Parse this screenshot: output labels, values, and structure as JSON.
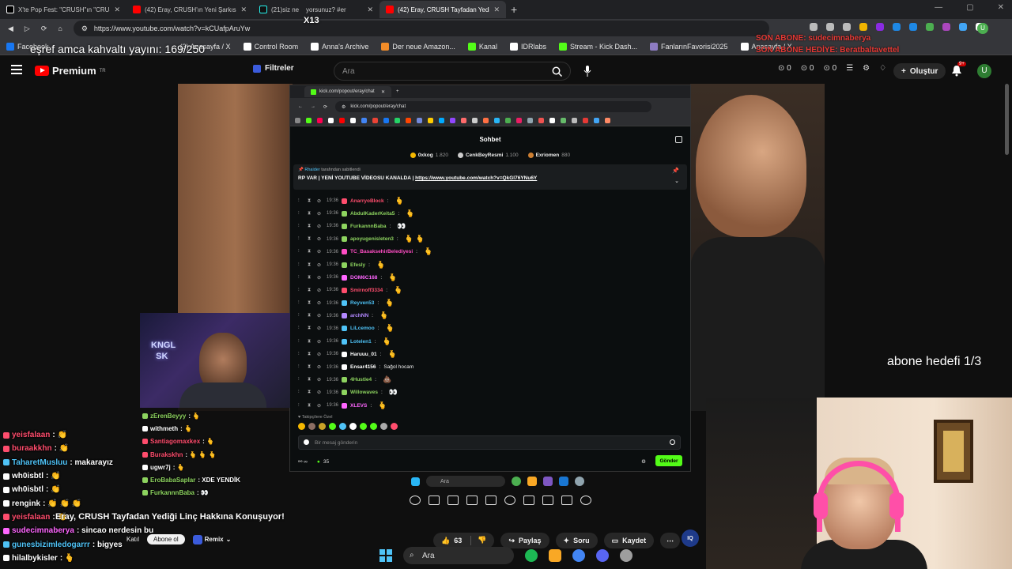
{
  "browser": {
    "tabs": [
      {
        "title": "X'te Pop Fest: \"CRUSH\"ın \"CRUSH",
        "icon": "x-icon",
        "color": "#ffffff",
        "active": false
      },
      {
        "title": "(42) Eray, CRUSH'ın Yeni Şarkısın",
        "icon": "youtube-icon",
        "color": "#ff0000",
        "active": false
      },
      {
        "title": "(21)siz ne",
        "title_tail": "yorsunuz? #er",
        "icon": "tiktok-icon",
        "color": "#ffffff",
        "active": false
      },
      {
        "title": "(42) Eray, CRUSH Tayfadan Yediğ",
        "icon": "youtube-icon",
        "color": "#ff0000",
        "active": true
      }
    ],
    "url": "https://www.youtube.com/watch?v=kCUafpAruYw",
    "bookmarks": [
      {
        "label": "Facebook",
        "color": "#1877f2"
      },
      {
        "label": "(3) Anasayfa / X",
        "color": "#ffffff"
      },
      {
        "label": "Control Room",
        "color": "#ffffff"
      },
      {
        "label": "Anna's Archive",
        "color": "#ffffff"
      },
      {
        "label": "Der neue Amazon...",
        "color": "#f28c28"
      },
      {
        "label": "Kanal",
        "color": "#53fc18"
      },
      {
        "label": "IDRlabs",
        "color": "#ffffff"
      },
      {
        "label": "Stream - Kick Dash...",
        "color": "#53fc18"
      },
      {
        "label": "FanlarınFavorisi2025",
        "color": "#8e7cc3"
      },
      {
        "label": "Anasayfa / X",
        "color": "#ffffff"
      }
    ]
  },
  "overlay": {
    "subgoal_counter": "eşref amca kahvaltı yayını: 169/250",
    "gift_count": "X13",
    "son_abone": "SON ABONE: sudecimnaberya",
    "son_abone_hediye": "SON ABONE HEDİYE: Beratbaltavettel",
    "abone_hedefi": "abone hedefi 1/3"
  },
  "youtube": {
    "brand": "Premium",
    "region": "TR",
    "filters_label": "Filtreler",
    "search_placeholder": "Ara",
    "counters": [
      "0",
      "0",
      "0"
    ],
    "create_label": "Oluştur",
    "notif_badge": "9+",
    "avatar_letter": "U",
    "video_title": "Eray, CRUSH Tayfadan Yediği Linç Hakkına Konuşuyor!",
    "join_label": "Katıl",
    "subscribe_label": "Abone ol",
    "remix_label": "Remix",
    "likes": "63",
    "share_label": "Paylaş",
    "ask_label": "Soru",
    "save_label": "Kaydet",
    "iq_label": "IQ"
  },
  "kick": {
    "tab_title": "kick.com/popout/eray/chat",
    "url": "kick.com/popout/eray/chat",
    "header": "Sohbet",
    "top_gifters": [
      {
        "name": "0xkog",
        "amount": "1.820",
        "color": "#f5b800"
      },
      {
        "name": "CenkBeyResmi",
        "amount": "1.100",
        "color": "#cccccc"
      },
      {
        "name": "Exriomen",
        "amount": "880",
        "color": "#cd7f32"
      }
    ],
    "pinned_by_user": "Rhaider",
    "pinned_by_suffix": "tarafından sabitlendi",
    "pinned_text": "RP VAR | YENİ YOUTUBE VİDEOSU KANALDA | ",
    "pinned_link": "https://www.youtube.com/watch?v=QkGl76YNu6Y",
    "messages": [
      {
        "time": "19:36",
        "user": "AnarryoBlock",
        "color": "#ff4d6d",
        "text": "",
        "emote": "🫰"
      },
      {
        "time": "19:36",
        "user": "AbdulKaderKeita5",
        "color": "#8dd35f",
        "text": "",
        "emote": "🫰"
      },
      {
        "time": "19:36",
        "user": "FurkannnBaba",
        "color": "#8dd35f",
        "text": "",
        "emote": "👀"
      },
      {
        "time": "19:36",
        "user": "apoyugenisleten3",
        "color": "#8dd35f",
        "text": "",
        "emote": "🫰 🫰"
      },
      {
        "time": "19:36",
        "user": "TC_BasaksehirBelediyesi",
        "color": "#ff4dc4",
        "text": "",
        "emote": "🫰"
      },
      {
        "time": "19:36",
        "user": "Efesly",
        "color": "#8dd35f",
        "text": "",
        "emote": "🫰"
      },
      {
        "time": "19:36",
        "user": "DOM6C168",
        "color": "#ff66ff",
        "text": "",
        "emote": "🫰"
      },
      {
        "time": "19:36",
        "user": "Smirnoff3334",
        "color": "#ff4d6d",
        "text": "",
        "emote": "🫰"
      },
      {
        "time": "19:36",
        "user": "Reyven53",
        "color": "#4fc3f7",
        "text": "",
        "emote": "🫰"
      },
      {
        "time": "19:36",
        "user": "archNN",
        "color": "#b388ff",
        "text": "",
        "emote": "🫰"
      },
      {
        "time": "19:36",
        "user": "LiLcemoo",
        "color": "#4fc3f7",
        "text": "",
        "emote": "🫰"
      },
      {
        "time": "19:36",
        "user": "Lotelen1",
        "color": "#4fc3f7",
        "text": "",
        "emote": "🫰"
      },
      {
        "time": "19:36",
        "user": "Haruuu_01",
        "color": "#ffffff",
        "text": "",
        "emote": "🫰"
      },
      {
        "time": "19:36",
        "user": "Ensar4156",
        "color": "#ffffff",
        "text": "Sağol hocam",
        "emote": ""
      },
      {
        "time": "19:36",
        "user": "4Hustle4",
        "color": "#8dd35f",
        "text": "",
        "emote": "💩"
      },
      {
        "time": "19:36",
        "user": "Willowaves",
        "color": "#8dd35f",
        "text": "",
        "emote": "👀"
      },
      {
        "time": "19:36",
        "user": "XLEVS",
        "color": "#ff66ff",
        "text": "",
        "emote": "🫰"
      }
    ],
    "followers_label": "Takipçilere Özel",
    "input_placeholder": "Bir mesaj gönderin",
    "viewer_count": "35",
    "send_label": "Gönder"
  },
  "inner_taskbar": {
    "search_label": "Ara"
  },
  "small_chat": [
    {
      "user": "zErenBeyyy",
      "color": "#8dd35f",
      "text": ": 🫰"
    },
    {
      "user": "withmeth",
      "color": "#ffffff",
      "text": ": 🫰"
    },
    {
      "user": "Santiagomaxkex",
      "color": "#ff4d6d",
      "text": ": 🫰"
    },
    {
      "user": "Burakskhn",
      "color": "#ff4d6d",
      "text": ": 🫰 🫰 🫰"
    },
    {
      "user": "ugwr7j",
      "color": "#ffffff",
      "text": ": 🫰"
    },
    {
      "user": "EroBabaSaplar",
      "color": "#8dd35f",
      "text": ": XDE YENDİK"
    },
    {
      "user": "FurkannnBaba",
      "color": "#8dd35f",
      "text": ": 👀"
    }
  ],
  "stream_chat": [
    {
      "user": "yeisfalaan",
      "color": "#ff4d6d",
      "text": ": 👏"
    },
    {
      "user": "buraakkhn",
      "color": "#ff4d6d",
      "text": ": 👏"
    },
    {
      "user": "TaharetMusluu",
      "color": "#4fc3f7",
      "text": ": makarayız"
    },
    {
      "user": "wh0isbtl",
      "color": "#ffffff",
      "text": ": 👏"
    },
    {
      "user": "wh0isbtl",
      "color": "#ffffff",
      "text": ": 👏"
    },
    {
      "user": "rengink",
      "color": "#ffffff",
      "text": ": 👏 👏 👏"
    },
    {
      "user": "yeisfalaan",
      "color": "#ff4d6d",
      "text": ": 👏"
    },
    {
      "user": "sudecimnaberya",
      "color": "#ff66ff",
      "text": ": sincao nerdesin bu"
    },
    {
      "user": "gunesbizimledogarrr",
      "color": "#4fc3f7",
      "text": ": bigyes"
    },
    {
      "user": "hilalbykisler",
      "color": "#ffffff",
      "text": ": 🫰"
    }
  ],
  "taskbar": {
    "search_label": "Ara"
  }
}
